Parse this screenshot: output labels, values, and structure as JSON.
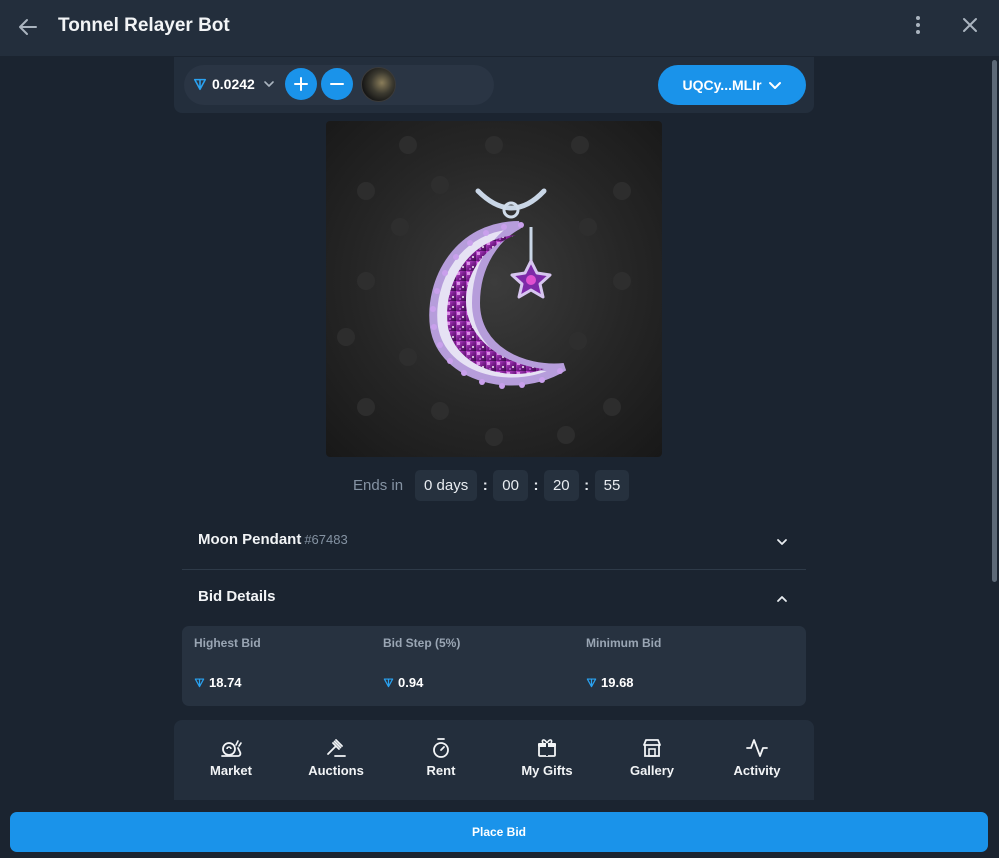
{
  "window": {
    "title": "Tonnel Relayer Bot"
  },
  "wallet": {
    "balance": "0.0242",
    "address": "UQCy...MLIr"
  },
  "gift": {
    "name": "Moon Pendant",
    "number": "#67483"
  },
  "timer": {
    "label": "Ends in",
    "days": "0 days",
    "hours": "00",
    "minutes": "20",
    "seconds": "55"
  },
  "bid_details": {
    "title": "Bid Details",
    "highest": {
      "label": "Highest Bid",
      "value": "18.74"
    },
    "step": {
      "label": "Bid Step (5%)",
      "value": "0.94"
    },
    "minimum": {
      "label": "Minimum Bid",
      "value": "19.68"
    }
  },
  "nav": {
    "market": "Market",
    "auctions": "Auctions",
    "rent": "Rent",
    "my_gifts": "My Gifts",
    "gallery": "Gallery",
    "activity": "Activity"
  },
  "action": {
    "place_bid": "Place Bid"
  },
  "colors": {
    "accent": "#1a93ea",
    "background": "#1b2430",
    "panel": "#232e3c",
    "ton": "#2aa2f0"
  },
  "icons": {
    "back": "arrow-left-icon",
    "more": "more-vertical-icon",
    "close": "close-icon",
    "ton": "ton-icon",
    "plus": "plus-icon",
    "minus": "minus-icon",
    "market": "snail-icon",
    "auctions": "gavel-icon",
    "rent": "stopwatch-icon",
    "my_gifts": "gift-icon",
    "gallery": "store-icon",
    "activity": "activity-icon"
  }
}
